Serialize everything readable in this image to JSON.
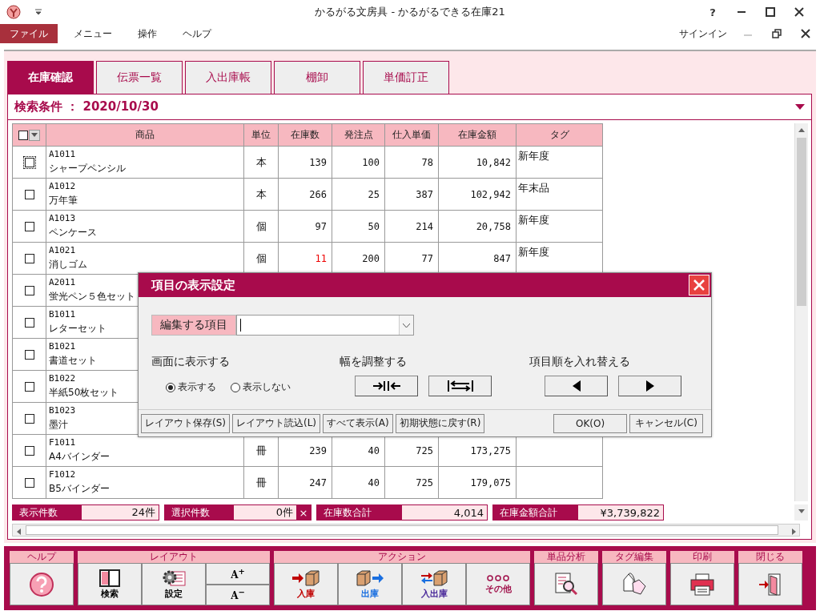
{
  "window": {
    "title": "かるがる文房具 - かるがるできる在庫21",
    "help": "?"
  },
  "menu": {
    "items": [
      {
        "label": "ファイル",
        "selected": true
      },
      {
        "label": "メニュー",
        "selected": false
      },
      {
        "label": "操作",
        "selected": false
      },
      {
        "label": "ヘルプ",
        "selected": false
      }
    ],
    "account": "サインイン"
  },
  "tabs": [
    {
      "label": "在庫確認",
      "selected": true
    },
    {
      "label": "伝票一覧",
      "selected": false
    },
    {
      "label": "入出庫帳",
      "selected": false
    },
    {
      "label": "棚卸",
      "selected": false
    },
    {
      "label": "単価訂正",
      "selected": false
    }
  ],
  "search_condition": "検索条件 ： 2020/10/30",
  "table": {
    "select_all": {
      "checked": false
    },
    "columns": [
      "商品",
      "単位",
      "在庫数",
      "発注点",
      "仕入単価",
      "在庫金額",
      "タグ"
    ],
    "rows": [
      {
        "code": "A1011",
        "name": "シャープペンシル",
        "unit": "本",
        "stock": "139",
        "reorder_point": "100",
        "unit_cost": "78",
        "value": "10,842",
        "tag": "新年度",
        "checked": false,
        "focused": true,
        "low_stock": false
      },
      {
        "code": "A1012",
        "name": "万年筆",
        "unit": "本",
        "stock": "266",
        "reorder_point": "25",
        "unit_cost": "387",
        "value": "102,942",
        "tag": "年末品",
        "checked": false,
        "focused": false,
        "low_stock": false
      },
      {
        "code": "A1013",
        "name": "ペンケース",
        "unit": "個",
        "stock": "97",
        "reorder_point": "50",
        "unit_cost": "214",
        "value": "20,758",
        "tag": "新年度",
        "checked": false,
        "focused": false,
        "low_stock": false
      },
      {
        "code": "A1021",
        "name": "消しゴム",
        "unit": "個",
        "stock": "11",
        "reorder_point": "200",
        "unit_cost": "77",
        "value": "847",
        "tag": "新年度",
        "checked": false,
        "focused": false,
        "low_stock": true
      },
      {
        "code": "A2011",
        "name": "蛍光ペン５色セット",
        "checked": false,
        "focused": false
      },
      {
        "code": "B1011",
        "name": "レターセット",
        "checked": false,
        "focused": false
      },
      {
        "code": "B1021",
        "name": "書道セット",
        "checked": false,
        "focused": false
      },
      {
        "code": "B1022",
        "name": "半紙50枚セット",
        "checked": false,
        "focused": false
      },
      {
        "code": "B1023",
        "name": "墨汁",
        "checked": false,
        "focused": false
      },
      {
        "code": "F1011",
        "name": "A4バインダー",
        "unit": "冊",
        "stock": "239",
        "reorder_point": "40",
        "unit_cost": "725",
        "value": "173,275",
        "checked": false,
        "focused": false,
        "low_stock": false
      },
      {
        "code": "F1012",
        "name": "B5バインダー",
        "unit": "冊",
        "stock": "247",
        "reorder_point": "40",
        "unit_cost": "725",
        "value": "179,075",
        "checked": false,
        "focused": false,
        "low_stock": false
      }
    ]
  },
  "status": [
    {
      "label": "表示件数",
      "value": "24件"
    },
    {
      "label": "選択件数",
      "value": "0件",
      "clear": "×"
    },
    {
      "label": "在庫数合計",
      "value": "4,014"
    },
    {
      "label": "在庫金額合計",
      "value": "¥3,739,822"
    }
  ],
  "dialog": {
    "title": "項目の表示設定",
    "field": {
      "label": "編集する項目"
    },
    "sections": [
      {
        "kind": "radio",
        "title": "画面に表示する",
        "options": [
          {
            "label": "表示する",
            "selected": true
          },
          {
            "label": "表示しない",
            "selected": false
          }
        ]
      },
      {
        "kind": "width",
        "title": "幅を調整する"
      },
      {
        "kind": "order",
        "title": "項目順を入れ替える"
      }
    ],
    "actions": [
      "レイアウト保存(S)",
      "レイアウト読込(L)",
      "すべて表示(A)",
      "初期状態に戻す(R)"
    ],
    "confirm": [
      "OK(O)",
      "キャンセル(C)"
    ]
  },
  "toolbar": [
    {
      "label": "ヘルプ",
      "buttons": [
        {
          "kind": "icon"
        }
      ]
    },
    {
      "label": "レイアウト",
      "buttons": [
        {
          "kind": "labeled",
          "label": "検索",
          "color": "#000000"
        },
        {
          "kind": "labeled",
          "label": "設定",
          "color": "#000000"
        },
        {
          "kind": "small",
          "label": "A$^{+}$"
        },
        {
          "kind": "small",
          "label": "A$^{−}$"
        }
      ]
    },
    {
      "label": "アクション",
      "buttons": [
        {
          "kind": "labeled",
          "label": "入庫",
          "color": "#c00000"
        },
        {
          "kind": "labeled",
          "label": "出庫",
          "color": "#1a6fe0"
        },
        {
          "kind": "labeled",
          "label": "入出庫",
          "color": "#4b2a9a"
        },
        {
          "kind": "labeled",
          "label": "その他",
          "color": "#a0104a"
        }
      ]
    },
    {
      "label": "単品分析",
      "buttons": [
        {
          "kind": "icon"
        }
      ]
    },
    {
      "label": "タグ編集",
      "buttons": [
        {
          "kind": "icon"
        }
      ]
    },
    {
      "label": "印刷",
      "buttons": [
        {
          "kind": "icon"
        }
      ]
    },
    {
      "label": "閉じる",
      "buttons": [
        {
          "kind": "icon"
        }
      ]
    }
  ]
}
